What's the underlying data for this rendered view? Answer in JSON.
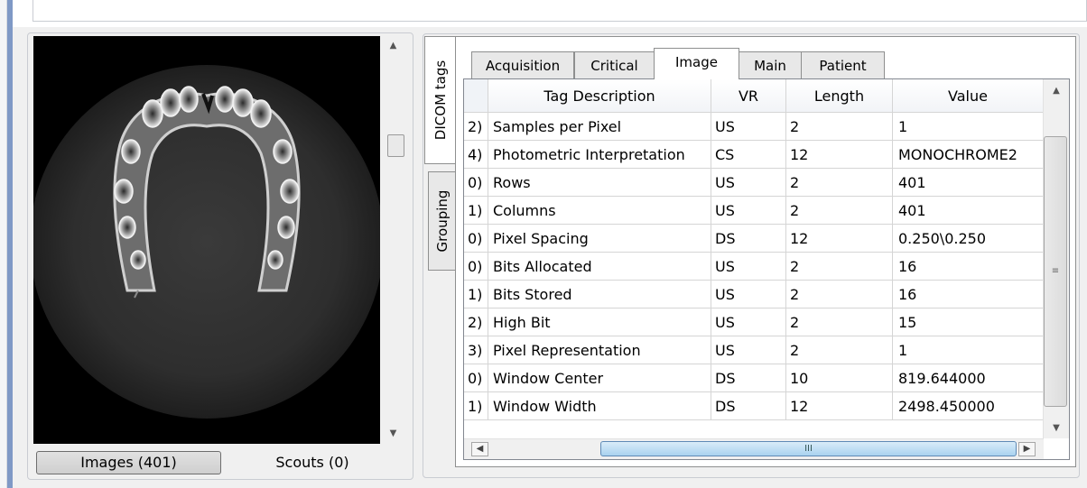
{
  "panel_buttons": {
    "images": "Images (401)",
    "scouts": "Scouts (0)"
  },
  "side_tabs": [
    {
      "label": "DICOM tags"
    },
    {
      "label": "Grouping"
    }
  ],
  "tabs": [
    {
      "label": "Acquisition"
    },
    {
      "label": "Critical"
    },
    {
      "label": "Image",
      "selected": true
    },
    {
      "label": "Main"
    },
    {
      "label": "Patient"
    }
  ],
  "table": {
    "columns": [
      "",
      "Tag Description",
      "VR",
      "Length",
      "Value"
    ],
    "rows": [
      {
        "tag": "2)",
        "description": "Samples per Pixel",
        "vr": "US",
        "length": "2",
        "value": "1"
      },
      {
        "tag": "4)",
        "description": "Photometric Interpretation",
        "vr": "CS",
        "length": "12",
        "value": "MONOCHROME2"
      },
      {
        "tag": "0)",
        "description": "Rows",
        "vr": "US",
        "length": "2",
        "value": "401"
      },
      {
        "tag": "1)",
        "description": "Columns",
        "vr": "US",
        "length": "2",
        "value": "401"
      },
      {
        "tag": "0)",
        "description": "Pixel Spacing",
        "vr": "DS",
        "length": "12",
        "value": "0.250\\0.250"
      },
      {
        "tag": "0)",
        "description": "Bits Allocated",
        "vr": "US",
        "length": "2",
        "value": "16"
      },
      {
        "tag": "1)",
        "description": "Bits Stored",
        "vr": "US",
        "length": "2",
        "value": "16"
      },
      {
        "tag": "2)",
        "description": "High Bit",
        "vr": "US",
        "length": "2",
        "value": "15"
      },
      {
        "tag": "3)",
        "description": "Pixel Representation",
        "vr": "US",
        "length": "2",
        "value": "1"
      },
      {
        "tag": "0)",
        "description": "Window Center",
        "vr": "DS",
        "length": "10",
        "value": "819.644000"
      },
      {
        "tag": "1)",
        "description": "Window Width",
        "vr": "DS",
        "length": "12",
        "value": "2498.450000"
      }
    ]
  },
  "icons": {
    "scroll_up": "▲",
    "scroll_down": "▼",
    "scroll_left": "◀",
    "scroll_right": "▶",
    "grip": "≡",
    "hgrip": "III"
  },
  "colors": {
    "accent_bar": "#7f99c6",
    "hscroll_thumb": "#a9d2ef"
  }
}
